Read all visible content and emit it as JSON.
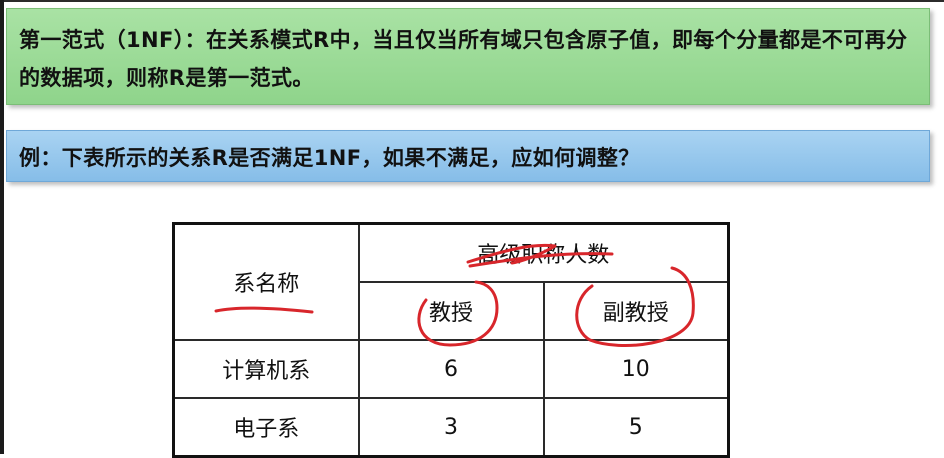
{
  "definition": "第一范式（1NF）：在关系模式R中，当且仅当所有域只包含原子值，即每个分量都是不可再分的数据项，则称R是第一范式。",
  "example": "例：下表所示的关系R是否满足1NF，如果不满足，应如何调整？",
  "table": {
    "header_row_label": "系名称",
    "group_header": "高级职称人数",
    "sub_headers": [
      "教授",
      "副教授"
    ],
    "rows": [
      {
        "name": "计算机系",
        "values": [
          "6",
          "10"
        ]
      },
      {
        "name": "电子系",
        "values": [
          "3",
          "5"
        ]
      }
    ]
  },
  "annotation_color": "#d8262b",
  "box_colors": {
    "definition": "#9bdb96",
    "example": "#93c7ee"
  }
}
